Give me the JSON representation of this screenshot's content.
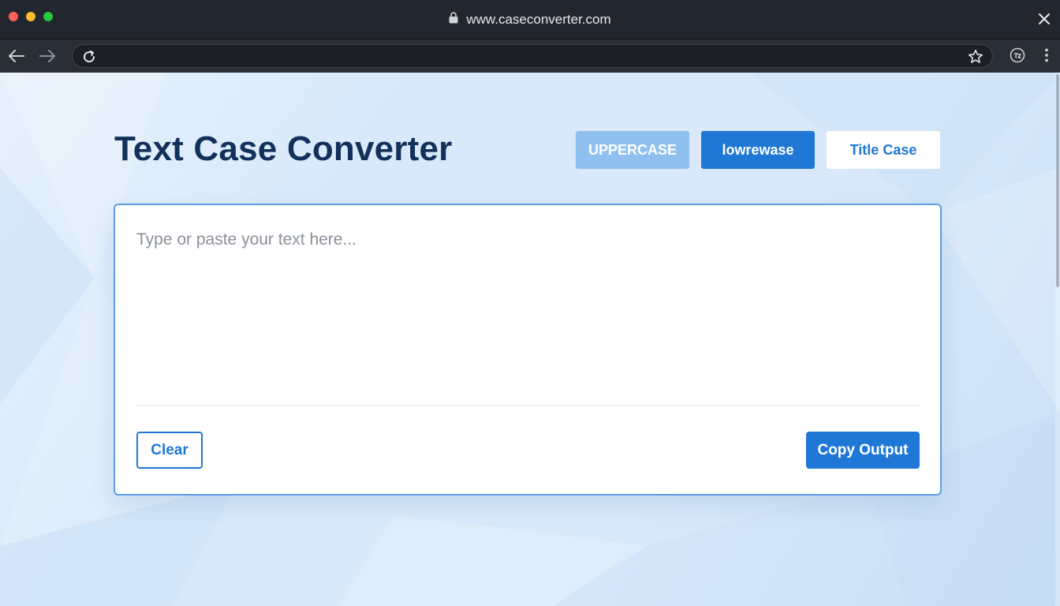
{
  "browser": {
    "url": "www.caseconverter.com",
    "icons": {
      "lock": "lock-icon",
      "close": "close-icon",
      "back": "arrow-left-icon",
      "forward": "arrow-right-icon",
      "reload": "reload-icon",
      "bookmark": "star-icon",
      "extension": "extension-icon",
      "menu": "more-vertical-icon"
    }
  },
  "page": {
    "title": "Text Case Converter",
    "case_buttons": {
      "uppercase": "UPPERCASE",
      "lowercase": "lowrewase",
      "titlecase": "Title Case"
    },
    "editor": {
      "value": "",
      "placeholder": "Type or paste your text here..."
    },
    "actions": {
      "clear": "Clear",
      "copy": "Copy Output"
    }
  },
  "colors": {
    "accent": "#1f77d6",
    "accent_light": "#8fc0f0",
    "title": "#13305a",
    "background": "#d9e9fa",
    "card_border": "#5c9ee3"
  }
}
